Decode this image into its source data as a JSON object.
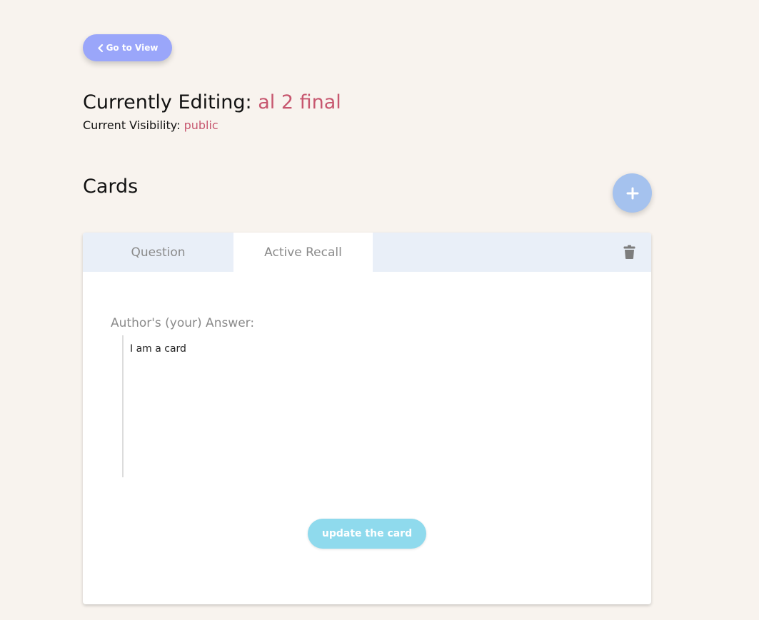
{
  "nav": {
    "back_label": "Go to View"
  },
  "editing": {
    "prefix": "Currently Editing:",
    "deck_name": "al 2 final",
    "visibility_prefix": "Current Visibility:",
    "visibility_value": "public"
  },
  "cards": {
    "heading": "Cards",
    "add_icon": "plus-icon",
    "card": {
      "tabs": [
        {
          "label": "Question",
          "active": false
        },
        {
          "label": "Active Recall",
          "active": true
        }
      ],
      "delete_icon": "trash-icon",
      "answer_label": "Author's (your) Answer:",
      "answer_text": "I am a card",
      "update_label": "update the card"
    }
  },
  "colors": {
    "background": "#f8f3ee",
    "accent": "#c7576f",
    "back_button": "#9aa6fa",
    "add_button": "#a5c2ee",
    "tab_bar": "#e9eff8",
    "update_button": "#8fdaed"
  }
}
